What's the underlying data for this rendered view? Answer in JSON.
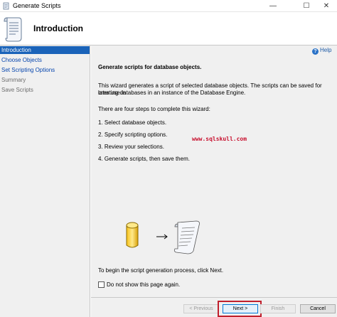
{
  "window": {
    "title": "Generate Scripts"
  },
  "header": {
    "title": "Introduction"
  },
  "sidebar": {
    "items": [
      {
        "label": "Introduction",
        "state": "selected"
      },
      {
        "label": "Choose Objects",
        "state": "link"
      },
      {
        "label": "Set Scripting Options",
        "state": "link"
      },
      {
        "label": "Summary",
        "state": "disabled"
      },
      {
        "label": "Save Scripts",
        "state": "disabled"
      }
    ]
  },
  "content": {
    "help_label": "Help",
    "subtitle": "Generate scripts for database objects.",
    "description_1": "This wizard generates a script of selected database objects. The scripts can be saved for later use in",
    "description_2": "creating databases in an instance of the Database Engine.",
    "steps_intro": "There are four steps to complete this wizard:",
    "steps": [
      "1. Select database objects.",
      "2. Specify scripting options.",
      "3. Review your selections.",
      "4. Generate scripts, then save them."
    ],
    "watermark": "www.sqlskull.com",
    "begin_text": "To begin the script generation process, click Next.",
    "checkbox_label": "Do not show this page again."
  },
  "footer": {
    "previous": "< Previous",
    "next": "Next >",
    "finish": "Finish",
    "cancel": "Cancel"
  },
  "colors": {
    "selected": "#1a63b9",
    "highlight": "#c0202d",
    "watermark": "#c8102e"
  }
}
